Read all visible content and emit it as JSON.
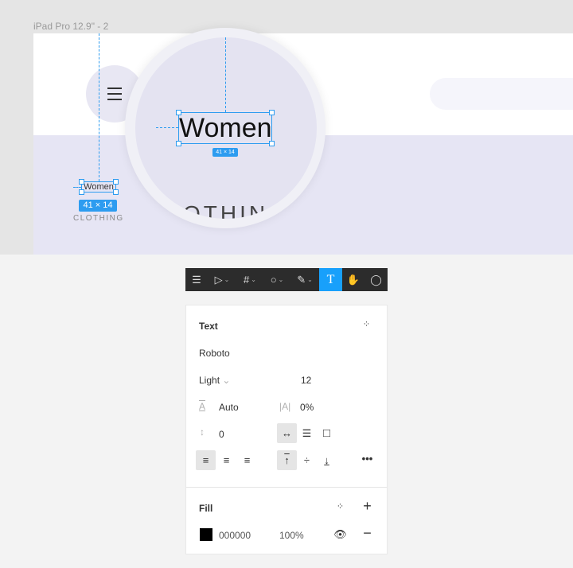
{
  "canvas": {
    "frame_label": "iPad Pro 12.9\" - 2",
    "small_text": "Women",
    "small_badge": "41 × 14",
    "clothing": "CLOTHING",
    "magnified_text": "Women",
    "magnified_badge": "41 × 14",
    "magnified_clothing": "OTHIN",
    "selection_color": "#2d9cf0"
  },
  "toolbar": {
    "tools": [
      {
        "icon": "menu-icon"
      },
      {
        "icon": "move-icon"
      },
      {
        "icon": "frame-icon"
      },
      {
        "icon": "ellipse-icon"
      },
      {
        "icon": "pen-icon"
      },
      {
        "icon": "text-icon",
        "active": true
      },
      {
        "icon": "hand-icon"
      },
      {
        "icon": "comment-icon"
      }
    ],
    "active_color": "#18a0fb"
  },
  "text_panel": {
    "title": "Text",
    "font_family": "Roboto",
    "font_weight": "Light",
    "font_size": "12",
    "line_height": "Auto",
    "letter_spacing": "0%",
    "paragraph_spacing": "0"
  },
  "fill_panel": {
    "title": "Fill",
    "color_hex": "000000",
    "opacity": "100%",
    "swatch_color": "#000000"
  }
}
